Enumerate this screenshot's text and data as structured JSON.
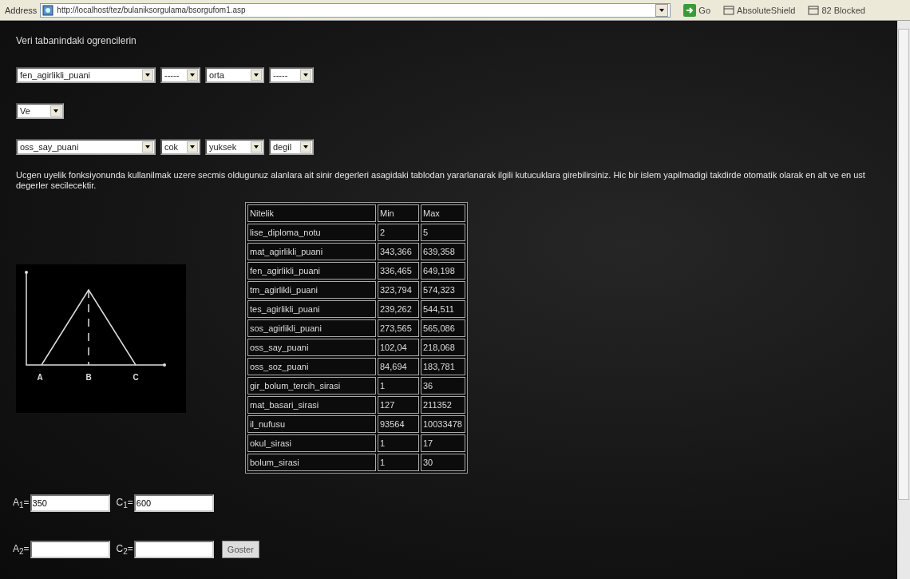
{
  "address_bar": {
    "label": "Address",
    "url": "http://localhost/tez/bulaniksorgulama/bsorgufom1.asp",
    "go": "Go",
    "toolbar_items": [
      "AbsoluteShield",
      "82 Blocked"
    ]
  },
  "intro": "Veri tabanindaki ogrencilerin",
  "condition_rows": [
    {
      "selects": [
        "fen_agirlikli_puani",
        "-----",
        "orta",
        "-----"
      ]
    },
    {
      "selects": [
        "Ve"
      ]
    },
    {
      "selects": [
        "oss_say_puani",
        "cok",
        "yuksek",
        "degil"
      ]
    }
  ],
  "description": "Ucgen uyelik fonksiyonunda kullanilmak uzere secmis oldugunuz alanlara ait sinir degerleri asagidaki tablodan yararlanarak ilgili kutucuklara girebilirsiniz. Hic bir islem yapilmadigi takdirde otomatik olarak en alt ve en ust degerler secilecektir.",
  "diagram": {
    "labels": [
      "A",
      "B",
      "C"
    ]
  },
  "table": {
    "columns": [
      "Nitelik",
      "Min",
      "Max"
    ],
    "rows": [
      [
        "lise_diploma_notu",
        "2",
        "5"
      ],
      [
        "mat_agirlikli_puani",
        "343,366",
        "639,358"
      ],
      [
        "fen_agirlikli_puani",
        "336,465",
        "649,198"
      ],
      [
        "tm_agirlikli_puani",
        "323,794",
        "574,323"
      ],
      [
        "tes_agirlikli_puani",
        "239,262",
        "544,511"
      ],
      [
        "sos_agirlikli_puani",
        "273,565",
        "565,086"
      ],
      [
        "oss_say_puani",
        "102,04",
        "218,068"
      ],
      [
        "oss_soz_puani",
        "84,694",
        "183,781"
      ],
      [
        "gir_bolum_tercih_sirasi",
        "1",
        "36"
      ],
      [
        "mat_basari_sirasi",
        "127",
        "211352"
      ],
      [
        "il_nufusu",
        "93564",
        "10033478"
      ],
      [
        "okul_sirasi",
        "1",
        "17"
      ],
      [
        "bolum_sirasi",
        "1",
        "30"
      ]
    ]
  },
  "input_rows": [
    {
      "fields": [
        {
          "label": "A$_{1}$=",
          "value": "350"
        },
        {
          "label": "C$_{1}$=",
          "value": "600"
        }
      ]
    },
    {
      "fields": [
        {
          "label": "A$_{2}$="
        },
        {
          "label": "C$_{2}$="
        }
      ],
      "button": "Goster"
    }
  ]
}
